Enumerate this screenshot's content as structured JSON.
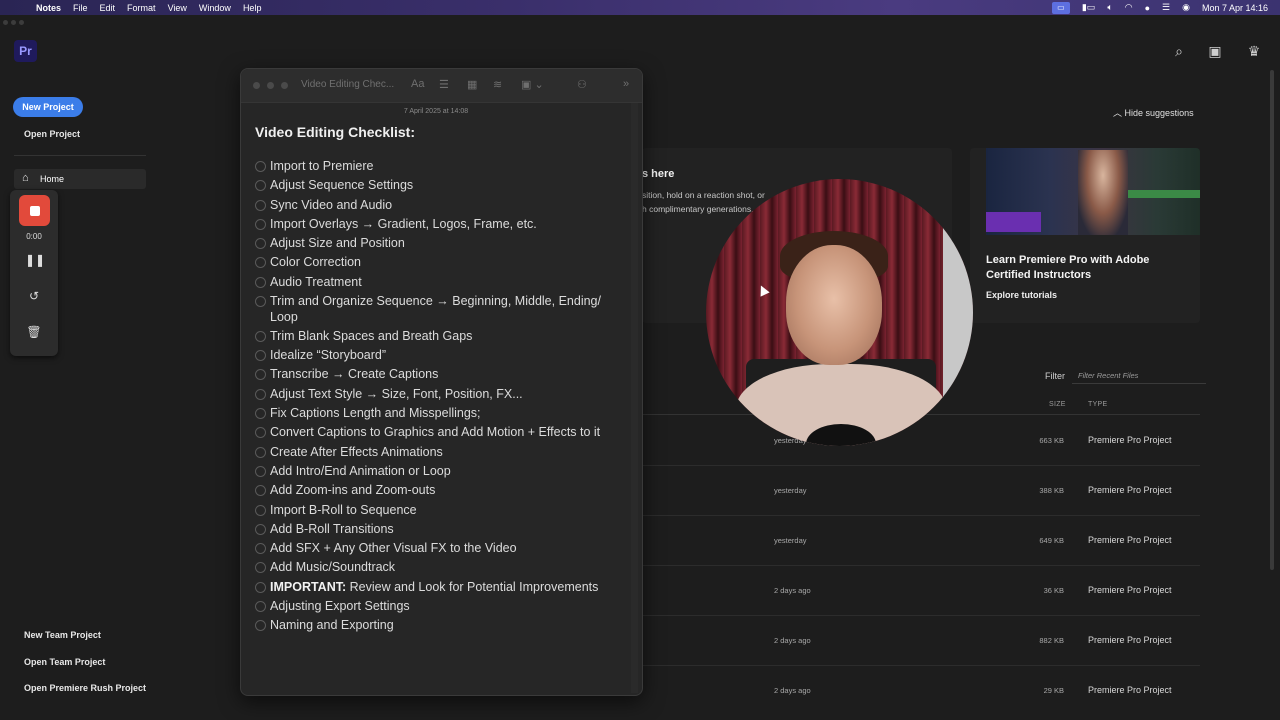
{
  "menubar": {
    "app": "Notes",
    "items": [
      "File",
      "Edit",
      "Format",
      "View",
      "Window",
      "Help"
    ],
    "clock": "Mon 7 Apr  14:16"
  },
  "premiere": {
    "logo": "Pr",
    "new_project": "New Project",
    "open_project": "Open Project",
    "home": "Home",
    "new_team_project": "New Team Project",
    "open_team_project": "Open Team Project",
    "open_rush_project": "Open Premiere Rush Project",
    "hide_suggestions": "Hide suggestions",
    "suggestion_a": {
      "title": "s here",
      "desc": "sition, hold on a reaction shot, or",
      "desc2": "h complimentary generations."
    },
    "suggestion_b": {
      "title": "Learn Premiere Pro with Adobe Certified Instructors",
      "link": "Explore tutorials"
    },
    "filter_label": "Filter",
    "filter_placeholder": "Filter Recent Files",
    "columns": {
      "size": "SIZE",
      "type": "TYPE"
    },
    "rows": [
      {
        "modified": "yesterday",
        "size": "663 KB",
        "type": "Premiere Pro Project"
      },
      {
        "modified": "yesterday",
        "size": "388 KB",
        "type": "Premiere Pro Project"
      },
      {
        "modified": "yesterday",
        "size": "649 KB",
        "type": "Premiere Pro Project"
      },
      {
        "modified": "2 days ago",
        "size": "36 KB",
        "type": "Premiere Pro Project"
      },
      {
        "modified": "2 days ago",
        "size": "882 KB",
        "type": "Premiere Pro Project"
      },
      {
        "modified": "2 days ago",
        "size": "29 KB",
        "type": "Premiere Pro Project"
      }
    ]
  },
  "recorder": {
    "time": "0:00"
  },
  "notes": {
    "window_title": "Video Editing Chec...",
    "date": "7 April 2025 at 14:08",
    "heading": "Video Editing Checklist:",
    "items": [
      "Import to Premiere",
      "Adjust Sequence Settings",
      "Sync Video and Audio",
      "Import Overlays → Gradient, Logos, Frame, etc.",
      "Adjust Size and Position",
      "Color Correction",
      "Audio Treatment",
      "Trim and Organize Sequence → Beginning, Middle, Ending/ Loop",
      "Trim Blank Spaces and Breath Gaps",
      "Idealize “Storyboard”",
      "Transcribe → Create Captions",
      "Adjust Text Style → Size, Font, Position, FX...",
      "Fix Captions Length and Misspellings;",
      "Convert Captions to Graphics and Add Motion + Effects to it",
      "Create After Effects Animations",
      "Add Intro/End Animation or Loop",
      "Add Zoom-ins and Zoom-outs",
      "Import B-Roll to Sequence",
      "Add B-Roll Transitions",
      "Add SFX + Any Other Visual FX to the Video",
      "Add Music/Soundtrack",
      {
        "bold": "IMPORTANT:",
        "text": " Review and Look for Potential Improvements"
      },
      "Adjusting Export Settings",
      "Naming and Exporting"
    ]
  }
}
